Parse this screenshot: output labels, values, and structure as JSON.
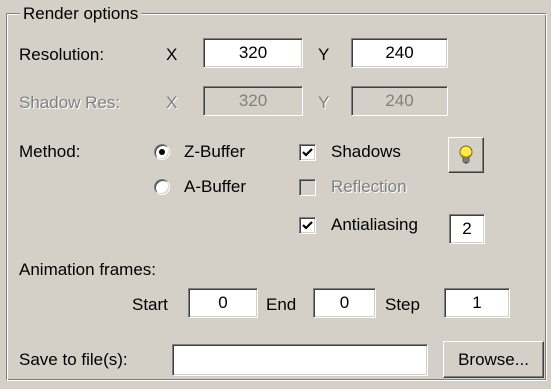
{
  "group": {
    "title": "Render options"
  },
  "resolution": {
    "label": "Resolution:",
    "x_label": "X",
    "x_value": "320",
    "y_label": "Y",
    "y_value": "240"
  },
  "shadow_res": {
    "label": "Shadow Res:",
    "x_label": "X",
    "x_value": "320",
    "y_label": "Y",
    "y_value": "240"
  },
  "method": {
    "label": "Method:",
    "options": [
      {
        "label": "Z-Buffer",
        "selected": true
      },
      {
        "label": "A-Buffer",
        "selected": false
      }
    ]
  },
  "checks": {
    "shadows": {
      "label": "Shadows",
      "checked": true
    },
    "reflection": {
      "label": "Reflection",
      "checked": false,
      "enabled": false
    },
    "antialiasing": {
      "label": "Antialiasing",
      "checked": true,
      "value": "2"
    }
  },
  "light_button": {
    "icon": "lightbulb-icon"
  },
  "animation": {
    "label": "Animation frames:",
    "start_label": "Start",
    "start_value": "0",
    "end_label": "End",
    "end_value": "0",
    "step_label": "Step",
    "step_value": "1"
  },
  "save": {
    "label": "Save to file(s):",
    "value": "",
    "browse_label": "Browse..."
  }
}
